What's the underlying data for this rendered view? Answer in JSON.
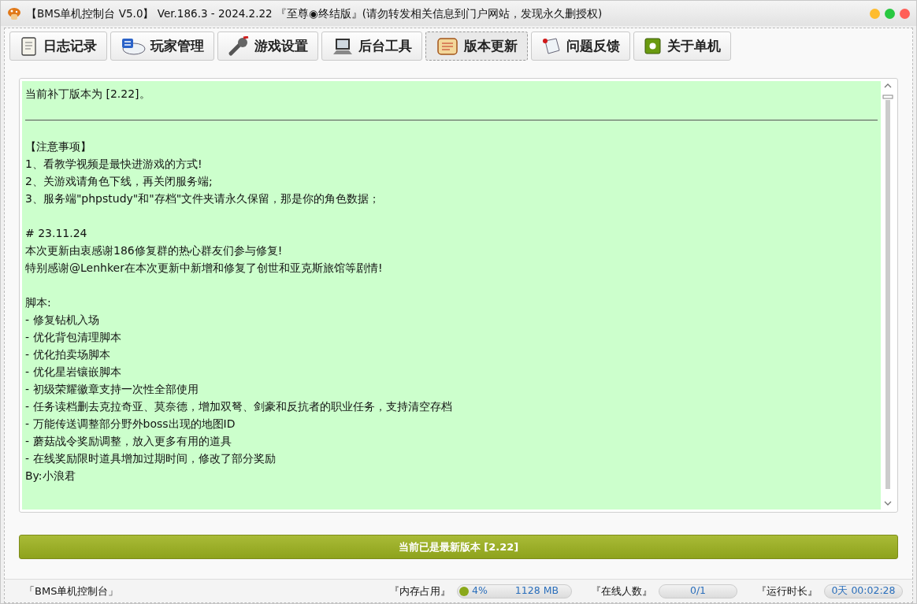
{
  "window": {
    "title": "【BMS单机控制台 V5.0】 Ver.186.3 - 2024.2.22 『至尊◉终结版』(请勿转发相关信息到门户网站，发现永久删授权)"
  },
  "tabs": [
    {
      "label": "日志记录",
      "selected": false
    },
    {
      "label": "玩家管理",
      "selected": false
    },
    {
      "label": "游戏设置",
      "selected": false
    },
    {
      "label": "后台工具",
      "selected": false
    },
    {
      "label": "版本更新",
      "selected": true
    },
    {
      "label": "问题反馈",
      "selected": false
    },
    {
      "label": "关于单机",
      "selected": false
    }
  ],
  "content": [
    {
      "kind": "text",
      "lines": [
        "当前补丁版本为 [2.22]。"
      ]
    },
    {
      "kind": "rule"
    },
    {
      "kind": "text",
      "lines": [
        "【注意事项】",
        "1、看教学视频是最快进游戏的方式!",
        "2、关游戏请角色下线，再关闭服务端;",
        "3、服务端\"phpstudy\"和\"存档\"文件夹请永久保留，那是你的角色数据；"
      ]
    },
    {
      "kind": "text",
      "lines": [
        "# 23.11.24",
        "本次更新由衷感谢186修复群的热心群友们参与修复!",
        "特别感谢@Lenhker在本次更新中新增和修复了创世和亚克斯旅馆等剧情!"
      ]
    },
    {
      "kind": "text",
      "lines": [
        "脚本:",
        "- 修复钻机入场",
        "- 优化背包清理脚本",
        "- 优化拍卖场脚本",
        "- 优化星岩镶嵌脚本",
        "- 初级荣耀徽章支持一次性全部使用",
        "- 任务读档删去克拉奇亚、莫奈德，增加双弩、剑豪和反抗者的职业任务，支持清空存档",
        "- 万能传送调整部分野外boss出现的地图ID",
        "- 蘑菇战令奖励调整，放入更多有用的道具",
        "- 在线奖励限时道具增加过期时间，修改了部分奖励",
        "By:小浪君"
      ]
    }
  ],
  "update_button": {
    "label": "当前已是最新版本 [2.22]"
  },
  "status_bar": {
    "app_label": "「BMS单机控制台」",
    "memory": {
      "label": "『内存占用』",
      "level": 0.04,
      "percent": "4%",
      "amount": "1128 MB"
    },
    "online": {
      "label": "『在线人数』",
      "value": "0/1"
    },
    "uptime": {
      "label": "『运行时长』",
      "value": "0天 00:02:28"
    }
  }
}
